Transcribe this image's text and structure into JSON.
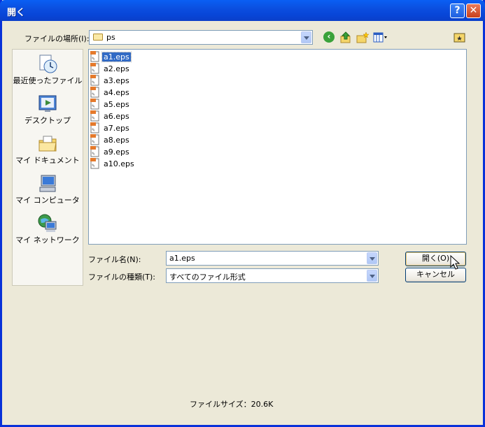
{
  "window": {
    "title": "開く"
  },
  "titlebar": {
    "help": "?",
    "close": "✕"
  },
  "lookin": {
    "label": "ファイルの場所(I):",
    "value": "ps"
  },
  "toolbar": {
    "back": "back-icon",
    "up": "up-folder-icon",
    "newfolder": "new-folder-icon",
    "views": "views-menu-icon",
    "desktop": "desktop-icon"
  },
  "places": [
    {
      "label": "最近使ったファイル",
      "icon": "recent-documents-icon"
    },
    {
      "label": "デスクトップ",
      "icon": "desktop-icon"
    },
    {
      "label": "マイ ドキュメント",
      "icon": "my-documents-icon"
    },
    {
      "label": "マイ コンピュータ",
      "icon": "my-computer-icon"
    },
    {
      "label": "マイ ネットワーク",
      "icon": "my-network-icon"
    }
  ],
  "files": [
    {
      "name": "a1.eps",
      "selected": true
    },
    {
      "name": "a2.eps"
    },
    {
      "name": "a3.eps"
    },
    {
      "name": "a4.eps"
    },
    {
      "name": "a5.eps"
    },
    {
      "name": "a6.eps"
    },
    {
      "name": "a7.eps"
    },
    {
      "name": "a8.eps"
    },
    {
      "name": "a9.eps"
    },
    {
      "name": "a10.eps"
    }
  ],
  "filename": {
    "label": "ファイル名(N):",
    "value": "a1.eps"
  },
  "filetype": {
    "label": "ファイルの種類(T):",
    "value": "すべてのファイル形式"
  },
  "buttons": {
    "open": "開く(O)",
    "cancel": "キャンセル"
  },
  "status": {
    "text": "ファイルサイズ：20.6K"
  },
  "colors": {
    "titlebar": "#0a5ff4",
    "selection": "#316ac5",
    "dialog_bg": "#ece9d8"
  }
}
